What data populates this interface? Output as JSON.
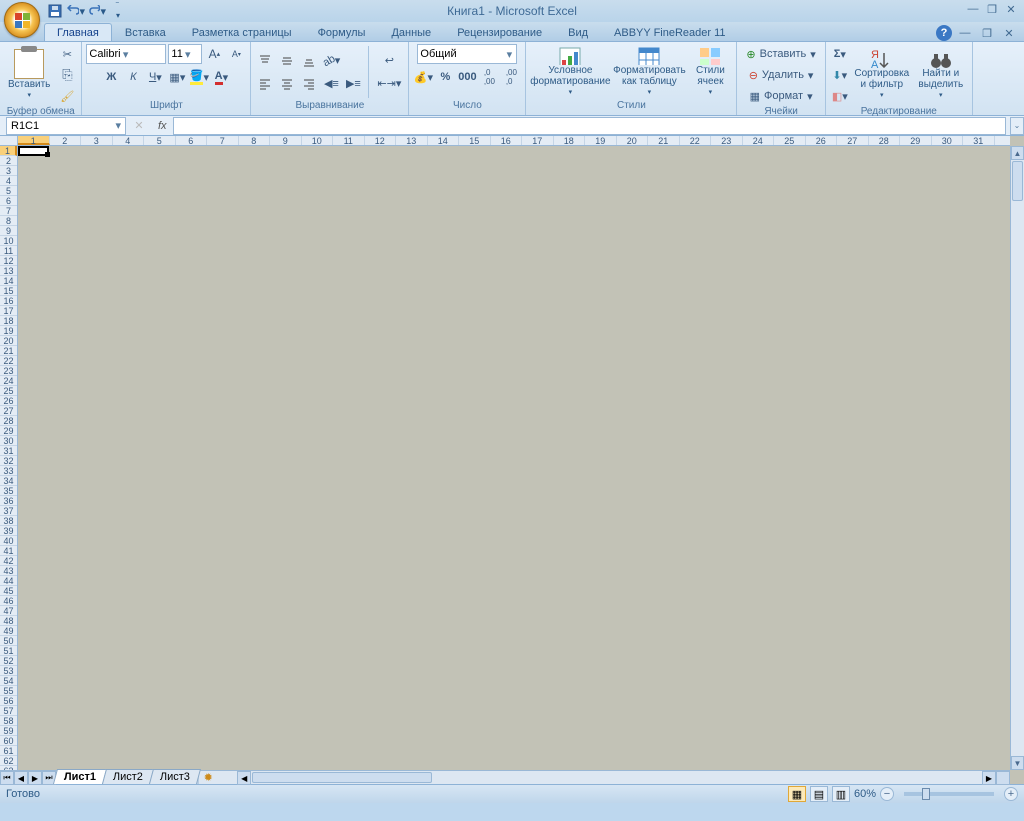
{
  "title": "Книга1 - Microsoft Excel",
  "qat": {
    "save": "save",
    "undo": "undo",
    "redo": "redo"
  },
  "tabs": [
    "Главная",
    "Вставка",
    "Разметка страницы",
    "Формулы",
    "Данные",
    "Рецензирование",
    "Вид",
    "ABBYY FineReader 11"
  ],
  "active_tab": 0,
  "ribbon": {
    "clipboard": {
      "paste": "Вставить",
      "label": "Буфер обмена"
    },
    "font": {
      "name": "Calibri",
      "size": "11",
      "label": "Шрифт",
      "bold": "Ж",
      "italic": "К",
      "underline": "Ч"
    },
    "align": {
      "label": "Выравнивание"
    },
    "number": {
      "format": "Общий",
      "label": "Число"
    },
    "styles": {
      "cond": "Условное форматирование",
      "table": "Форматировать как таблицу",
      "cell": "Стили ячеек",
      "label": "Стили"
    },
    "cells": {
      "insert": "Вставить",
      "delete": "Удалить",
      "format": "Формат",
      "label": "Ячейки"
    },
    "editing": {
      "sort": "Сортировка и фильтр",
      "find": "Найти и выделить",
      "label": "Редактирование"
    }
  },
  "name_box": "R1C1",
  "formula": "",
  "columns": 31,
  "rows": 63,
  "active_cell": {
    "row": 1,
    "col": 1
  },
  "sheets": [
    "Лист1",
    "Лист2",
    "Лист3"
  ],
  "active_sheet": 0,
  "status": "Готово",
  "zoom": "60%"
}
